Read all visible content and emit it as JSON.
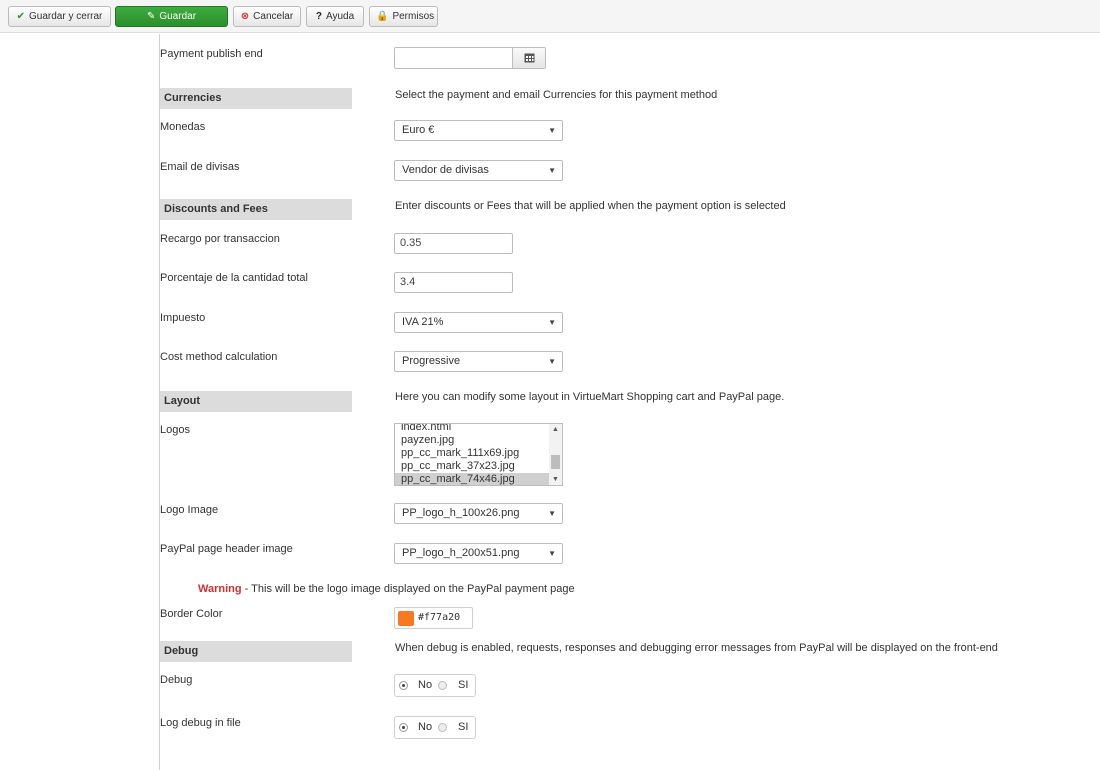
{
  "toolbar": {
    "save_close": "Guardar y cerrar",
    "save": "Guardar",
    "cancel": "Cancelar",
    "help": "Ayuda",
    "permissions": "Permisos"
  },
  "fields": {
    "publish_end": {
      "label": "Payment publish end",
      "value": ""
    },
    "currencies_section": {
      "title": "Currencies",
      "desc": "Select the payment and email Currencies for this payment method"
    },
    "monedas": {
      "label": "Monedas",
      "value": "Euro €"
    },
    "email_divisas": {
      "label": "Email de divisas",
      "value": "Vendor de divisas"
    },
    "fees_section": {
      "title": "Discounts and Fees",
      "desc": "Enter discounts or Fees that will be applied when the payment option is selected"
    },
    "recargo": {
      "label": "Recargo por transaccion",
      "value": "0.35"
    },
    "porcentaje": {
      "label": "Porcentaje de la cantidad total",
      "value": "3.4"
    },
    "impuesto": {
      "label": "Impuesto",
      "value": "IVA 21%"
    },
    "cost_method": {
      "label": "Cost method calculation",
      "value": "Progressive"
    },
    "layout_section": {
      "title": "Layout",
      "desc": "Here you can modify some layout in VirtueMart Shopping cart and PayPal page."
    },
    "logos": {
      "label": "Logos",
      "items": [
        "index.html",
        "payzen.jpg",
        "pp_cc_mark_111x69.jpg",
        "pp_cc_mark_37x23.jpg",
        "pp_cc_mark_74x46.jpg"
      ],
      "selected_index": 4
    },
    "logo_image": {
      "label": "Logo Image",
      "value": "PP_logo_h_100x26.png"
    },
    "header_image": {
      "label": "PayPal page header image",
      "value": "PP_logo_h_200x51.png"
    },
    "warning": {
      "strong": "Warning",
      "text": " - This will be the logo image displayed on the PayPal payment page"
    },
    "border_color": {
      "label": "Border Color",
      "value": "#f77a20"
    },
    "debug_section": {
      "title": "Debug",
      "desc": "When debug is enabled, requests, responses and debugging error messages from PayPal will be displayed on the front-end"
    },
    "debug": {
      "label": "Debug",
      "options": [
        "No",
        "SI"
      ],
      "selected": "No"
    },
    "log_debug": {
      "label": "Log debug in file",
      "options": [
        "No",
        "SI"
      ],
      "selected": "No"
    }
  },
  "colors": {
    "accent_green": "#2e8f2e",
    "warning_red": "#d32f2f",
    "swatch": "#f77a20"
  }
}
